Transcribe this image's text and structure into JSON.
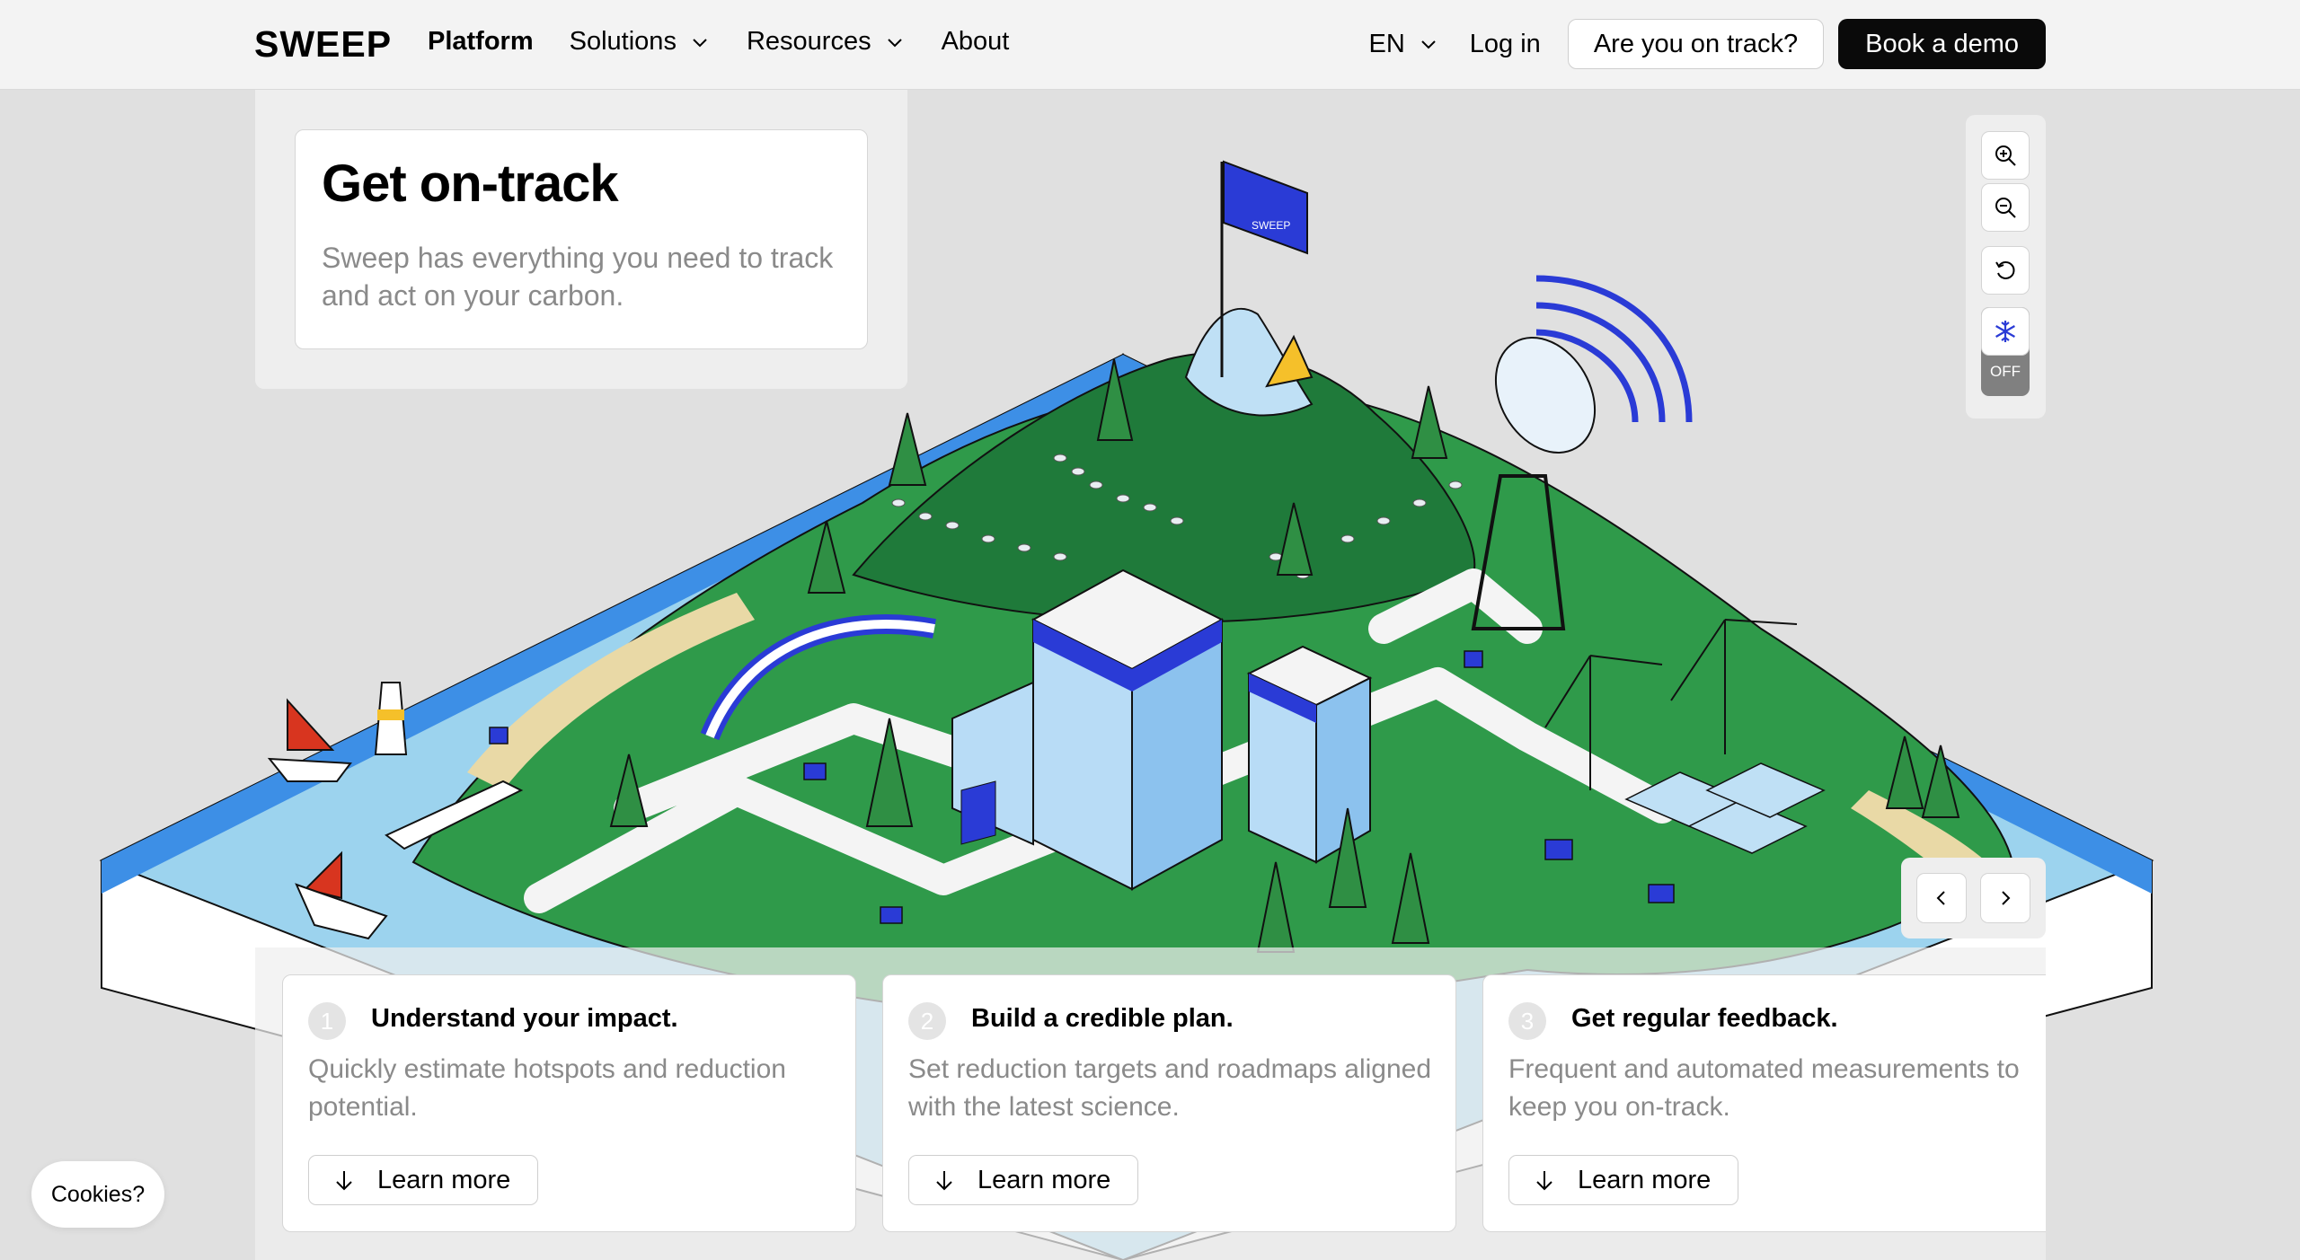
{
  "header": {
    "logo": "SWEEP",
    "nav": [
      {
        "label": "Platform"
      },
      {
        "label": "Solutions"
      },
      {
        "label": "Resources"
      },
      {
        "label": "About"
      }
    ],
    "language": "EN",
    "login": "Log in",
    "track_button": "Are you on track?",
    "demo_button": "Book a demo"
  },
  "hero": {
    "title": "Get on-track",
    "description": "Sweep has everything you need to track and act on your carbon."
  },
  "map_controls": {
    "snow_toggle_state": "OFF"
  },
  "scene": {
    "flag_text": "SWEEP"
  },
  "steps": [
    {
      "number": "1",
      "title": "Understand your impact.",
      "description": "Quickly estimate hotspots and reduction potential.",
      "button": "Learn more"
    },
    {
      "number": "2",
      "title": "Build a credible plan.",
      "description": "Set reduction targets and roadmaps aligned with the latest science.",
      "button": "Learn more"
    },
    {
      "number": "3",
      "title": "Get regular feedback.",
      "description": "Frequent and automated measurements to keep you on-track.",
      "button": "Learn more"
    }
  ],
  "cookies": "Cookies?",
  "colors": {
    "grass": "#2f9a4a",
    "water": "#4a9fe8",
    "brand_blue": "#2a3bd6",
    "button_dark": "#0a0a0a"
  }
}
